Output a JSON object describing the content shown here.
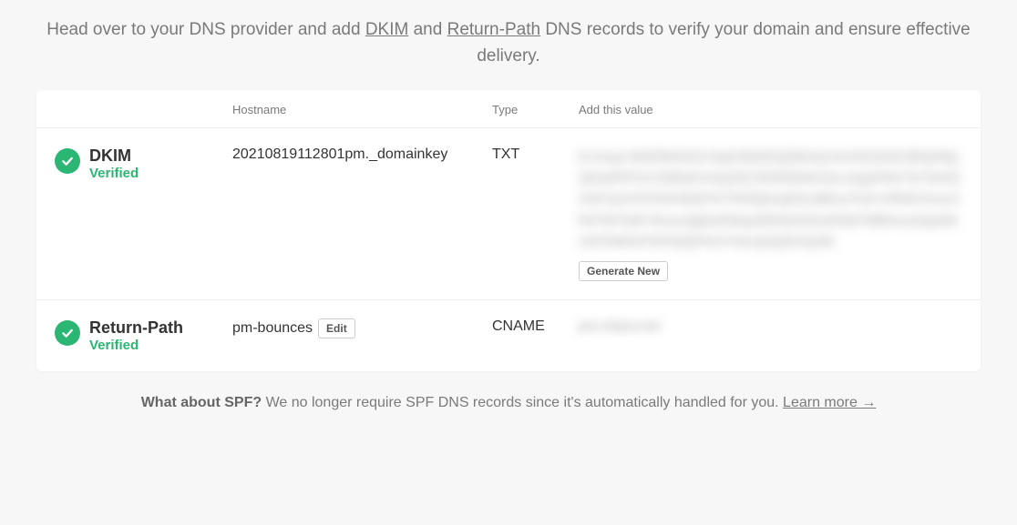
{
  "header": {
    "text_pre": "Head over to your DNS provider and add ",
    "link_dkim": "DKIM",
    "text_mid": " and ",
    "link_rp": "Return-Path",
    "text_post": " DNS records to verify your domain and ensure effective delivery."
  },
  "table": {
    "headers": {
      "hostname": "Hostname",
      "type": "Type",
      "value": "Add this value"
    },
    "rows": [
      {
        "title": "DKIM",
        "status": "Verified",
        "hostname": "20210819112801pm._domainkey",
        "type": "TXT",
        "value_blurred": "k=rsa;p=MIGfMA0GCSqGSIb3DQEBAQUAA4GNADCBiQKBgQDwIRP/UC3SBsEmGqZ9ZJW3/DkMoGeLnQg1fWn7/zYtIxN2SnFCjxOCKG9v3b4jYfcTNh5ijSsq631uBItLa7od+v/RtdC2UzJ1lWT947qR+Rcac2gbto/NMqJ0fzfVjH4OuKhitdY9tf6mcwGjaNBcWToIMmPSPDdQPNUYckcQ2QIDAQAB",
        "action": "Generate New"
      },
      {
        "title": "Return-Path",
        "status": "Verified",
        "hostname": "pm-bounces",
        "hostname_action": "Edit",
        "type": "CNAME",
        "value_blurred": "pm.mtasv.net"
      }
    ]
  },
  "footer": {
    "bold": "What about SPF?",
    "text": " We no longer require SPF DNS records since it's automatically handled for you. ",
    "link": "Learn more →"
  }
}
